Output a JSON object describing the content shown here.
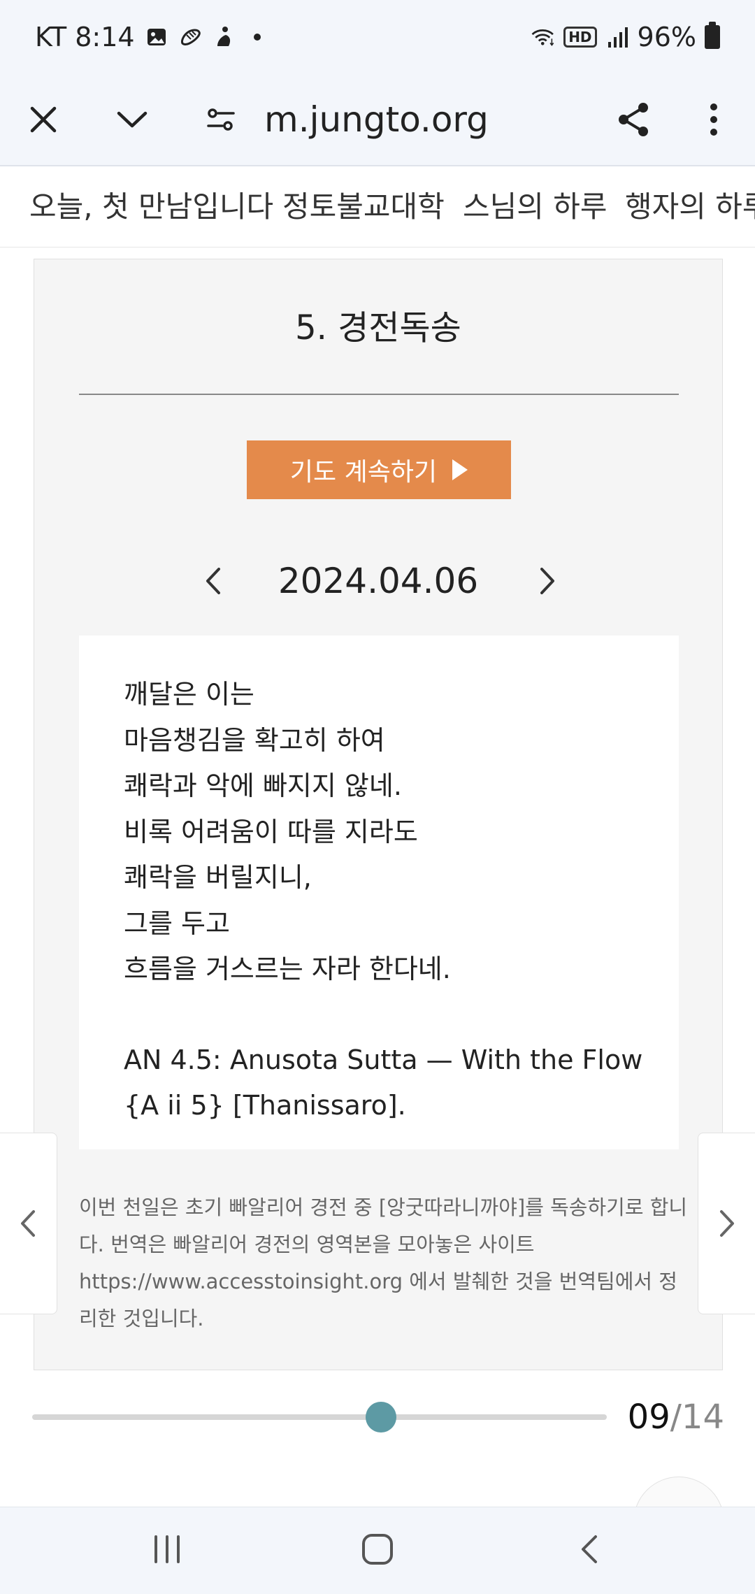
{
  "status_bar": {
    "carrier_time": "KT 8:14",
    "notification_icons": [
      "image-icon",
      "shoe-icon",
      "figure-icon",
      "dot-icon"
    ],
    "hd_label": "HD",
    "battery": "96%"
  },
  "browser": {
    "url": "m.jungto.org"
  },
  "site_nav": {
    "tabs": [
      "오늘, 첫 만남입니다",
      "정토불교대학",
      "스님의 하루",
      "행자의 하루"
    ]
  },
  "card": {
    "title": "5. 경전독송",
    "continue_label": "기도 계속하기",
    "date": "2024.04.06",
    "verse": [
      "깨달은 이는",
      "마음챙김을 확고히 하여",
      "쾌락과 악에 빠지지 않네.",
      "비록 어려움이 따를 지라도",
      "쾌락을 버릴지니,",
      "그를 두고",
      "흐름을 거스르는 자라 한다네."
    ],
    "citation": "AN 4.5: Anusota Sutta — With the Flow {A ii 5} [Thanissaro].",
    "note": "이번 천일은 초기 빠알리어 경전 중 [앙굿따라니까야]를 독송하기로 합니다. 번역은 빠알리어 경전의 영역본을 모아놓은 사이트 https://www.accesstoinsight.org 에서 발췌한 것을 번역팀에서 정리한 것입니다."
  },
  "progress": {
    "current": "09",
    "total": "/14",
    "fraction": 0.607
  },
  "colors": {
    "accent_orange": "#e48a4b",
    "slider_thumb": "#5d9aa4",
    "card_bg": "#f5f5f5",
    "chrome_bg": "#f3f6fb"
  }
}
